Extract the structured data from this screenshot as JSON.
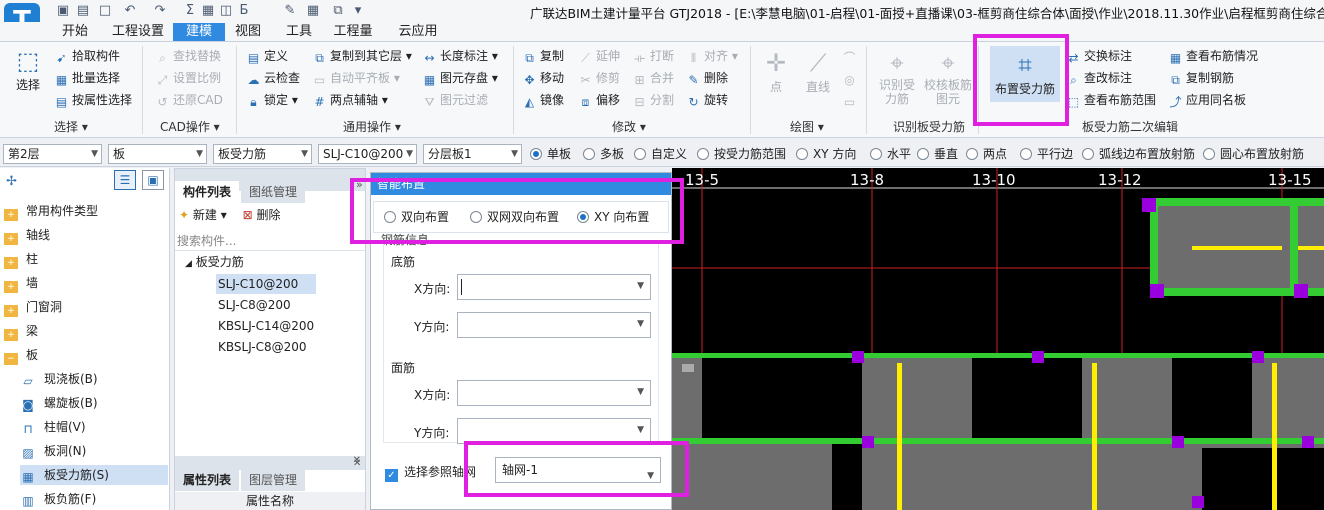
{
  "app": {
    "title": "广联达BIM土建计量平台 GTJ2018 - [E:\\李慧电脑\\01-启程\\01-面授+直播课\\03-框剪商住综合体\\面授\\作业\\2018.11.30作业\\启程框剪商住综合体(徐",
    "logo_letter": "T"
  },
  "menu": [
    "开始",
    "工程设置",
    "建模",
    "视图",
    "工具",
    "工程量",
    "云应用"
  ],
  "menu_active": "建模",
  "ribbon": {
    "select": {
      "big": "选择",
      "items": [
        "拾取构件",
        "批量选择",
        "按属性选择"
      ],
      "label": "选择"
    },
    "cad": {
      "items": [
        "查找替换",
        "设置比例",
        "还原CAD"
      ],
      "label": "CAD操作"
    },
    "common": {
      "items": [
        "定义",
        "云检查",
        "锁定",
        "复制到其它层",
        "自动平齐板",
        "两点辅轴",
        "长度标注",
        "图元存盘",
        "图元过滤"
      ],
      "label": "通用操作"
    },
    "modify": {
      "items": [
        "复制",
        "移动",
        "镜像",
        "延伸",
        "修剪",
        "偏移",
        "打断",
        "合并",
        "分割",
        "对齐",
        "删除",
        "旋转"
      ],
      "label": "修改"
    },
    "draw": {
      "items": [
        "点",
        "直线"
      ],
      "label": "绘图"
    },
    "identify": {
      "items": [
        "识别受力筋",
        "校核板筋图元"
      ],
      "label": "识别板受力筋"
    },
    "secondary": {
      "big": "布置受力筋",
      "items": [
        "交换标注",
        "查改标注",
        "查看布筋范围",
        "查看布筋情况",
        "复制钢筋",
        "应用同名板"
      ],
      "label": "板受力筋二次编辑"
    }
  },
  "toolbar": {
    "floor": "第2层",
    "category": "板",
    "type": "板受力筋",
    "component": "SLJ-C10@200",
    "layer": "分层板1",
    "options": [
      "单板",
      "多板",
      "自定义",
      "按受力筋范围",
      "XY 方向",
      "水平",
      "垂直",
      "两点",
      "平行边",
      "弧线边布置放射筋",
      "圆心布置放射筋"
    ],
    "selected_option": "单板"
  },
  "left_tree": {
    "top": [
      "常用构件类型",
      "轴线",
      "柱",
      "墙",
      "门窗洞",
      "梁",
      "板"
    ],
    "sub": [
      "现浇板(B)",
      "螺旋板(B)",
      "柱帽(V)",
      "板洞(N)",
      "板受力筋(S)",
      "板负筋(F)"
    ],
    "selected": "板受力筋(S)"
  },
  "component_panel": {
    "tabs": [
      "构件列表",
      "图纸管理"
    ],
    "new_label": "新建",
    "delete_label": "删除",
    "search_placeholder": "搜索构件...",
    "group": "板受力筋",
    "items": [
      "SLJ-C10@200",
      "SLJ-C8@200",
      "KBSLJ-C14@200",
      "KBSLJ-C8@200"
    ],
    "selected": "SLJ-C10@200",
    "prop_tabs": [
      "属性列表",
      "图层管理"
    ],
    "prop_header": "属性名称"
  },
  "dialog": {
    "title": "智能布置",
    "modes": [
      "双向布置",
      "双网双向布置",
      "XY 向布置"
    ],
    "selected_mode": "XY 向布置",
    "section": "钢筋信息",
    "bottom_label": "底筋",
    "top_label": "面筋",
    "x_label": "X方向:",
    "y_label": "Y方向:",
    "ref_axis_label": "选择参照轴网",
    "ref_axis_value": "轴网-1"
  },
  "cad": {
    "axis_labels": [
      "13-5",
      "13-8",
      "13-10",
      "13-12",
      "13-15"
    ]
  },
  "colors": {
    "accent": "#2f8ae0",
    "highlight": "#e020e0",
    "cad_bg": "#000000"
  }
}
